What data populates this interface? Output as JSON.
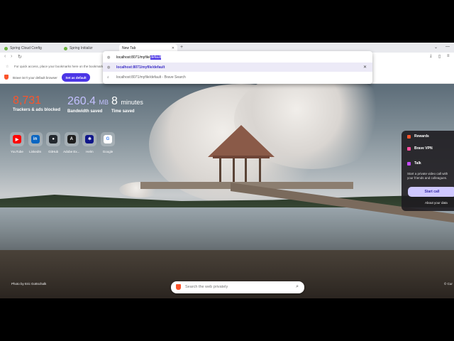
{
  "tabs": [
    {
      "label": "Spring Cloud Config"
    },
    {
      "label": "Spring Initializr"
    },
    {
      "label": "New Tab"
    }
  ],
  "omnibox": {
    "typed_prefix": "localhost:8071/myfile/",
    "typed_selected": "default",
    "suggestion_url": "localhost:8071/myfile/default",
    "suggestion_search": "localhost:8071/myfile/default - Brave Search"
  },
  "bookmarks_hint": "For quick access, place your bookmarks here on the bookmarks bar.",
  "infobar": {
    "message": "Brave isn't your default browser",
    "button": "Set as default"
  },
  "stats": {
    "trackers": {
      "value": "8,731",
      "label": "Trackers & ads blocked",
      "color": "#fb542b"
    },
    "bandwidth": {
      "value": "260.4",
      "unit": "MB",
      "label": "Bandwidth saved",
      "color": "#c3c0ff"
    },
    "time": {
      "value": "8",
      "unit": "minutes",
      "label": "Time saved",
      "color": "#ffffff"
    }
  },
  "top_sites": [
    {
      "name": "YouTube",
      "icon": "youtube-icon",
      "color": "#ff0000",
      "glyph": "▶"
    },
    {
      "name": "LinkedIn",
      "icon": "linkedin-icon",
      "color": "#0a66c2",
      "glyph": "in"
    },
    {
      "name": "GitHub",
      "icon": "github-icon",
      "color": "#24292f",
      "glyph": "●"
    },
    {
      "name": "Adobe Ex...",
      "icon": "adobe-express-icon",
      "color": "#1e1e1e",
      "glyph": "A"
    },
    {
      "name": "Helm",
      "icon": "helm-icon",
      "color": "#0f1689",
      "glyph": "⎈"
    },
    {
      "name": "Google",
      "icon": "google-icon",
      "color": "#ffffff",
      "glyph": "G"
    }
  ],
  "side_panel": {
    "rewards": "Rewards",
    "vpn": "Brave VPN",
    "talk": "Talk",
    "talk_desc": "Start a private video call with your friends and colleagues.",
    "start_call": "Start call",
    "about_data": "About your data"
  },
  "photo_credit": "Photo by Eric Gottschalk",
  "corner_text": "© Cur",
  "search": {
    "placeholder": "Search the web privately"
  }
}
